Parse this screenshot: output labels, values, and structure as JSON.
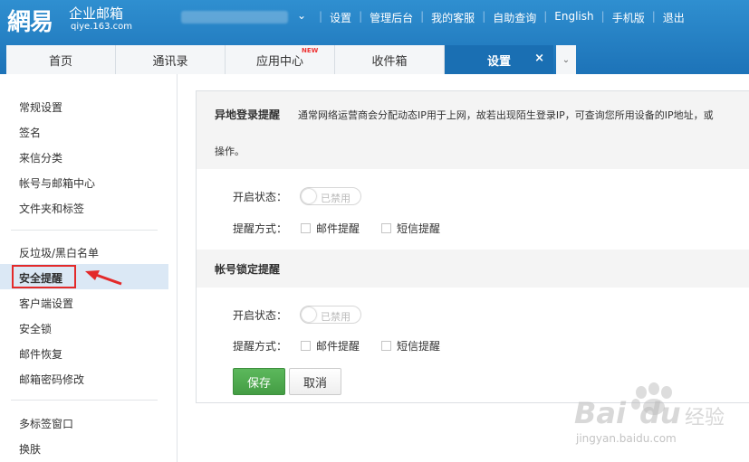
{
  "header": {
    "logo_brand": "網易",
    "logo_product": "企业邮箱",
    "logo_domain": "qiye.163.com",
    "account_caret": "⌄",
    "links": [
      "设置",
      "管理后台",
      "我的客服",
      "自助查询",
      "English",
      "手机版",
      "退出"
    ]
  },
  "tabs": [
    {
      "label": "首页"
    },
    {
      "label": "通讯录"
    },
    {
      "label": "应用中心",
      "badge": "NEW"
    },
    {
      "label": "收件箱"
    },
    {
      "label": "设置",
      "close": "×"
    }
  ],
  "tab_more": "⌄",
  "sidebar": {
    "group1": [
      "常规设置",
      "签名",
      "来信分类",
      "帐号与邮箱中心",
      "文件夹和标签"
    ],
    "group2": [
      "反垃圾/黑白名单",
      "安全提醒",
      "客户端设置",
      "安全锁",
      "邮件恢复",
      "邮箱密码修改"
    ],
    "group3": [
      "多标签窗口",
      "换肤"
    ]
  },
  "main": {
    "section1": {
      "title": "异地登录提醒",
      "desc_line1": "通常网络运营商会分配动态IP用于上网，故若出现陌生登录IP，可查询您所用设备的IP地址，或",
      "desc_line2": "操作。",
      "status_label": "开启状态：",
      "toggle_text": "已禁用",
      "method_label": "提醒方式：",
      "option_mail": "邮件提醒",
      "option_sms": "短信提醒"
    },
    "section2": {
      "title": "帐号锁定提醒",
      "status_label": "开启状态：",
      "toggle_text": "已禁用",
      "method_label": "提醒方式：",
      "option_mail": "邮件提醒",
      "option_sms": "短信提醒"
    },
    "save_label": "保存",
    "cancel_label": "取消"
  },
  "watermark": {
    "brand": "Bai",
    "brand2": "du",
    "suffix": "经验",
    "url": "jingyan.baidu.com"
  },
  "colors": {
    "header": "#1d73b8",
    "active_tab": "#1a6fb3",
    "save_button": "#4cae4c",
    "highlight": "#e32a2a"
  }
}
